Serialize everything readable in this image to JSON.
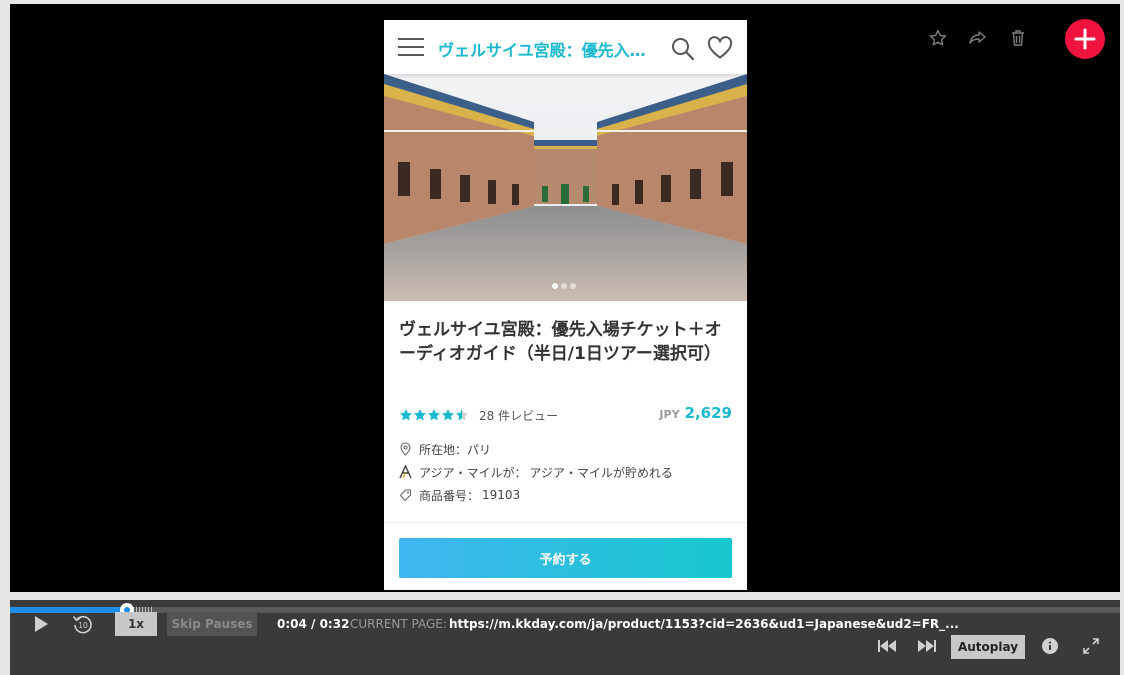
{
  "stage_toolbar": {
    "favorite_icon": "star-outline-icon",
    "share_icon": "share-arrow-icon",
    "delete_icon": "trash-icon",
    "add_icon": "plus-icon",
    "add_color": "#f0123f"
  },
  "phone": {
    "header": {
      "title": "ヴェルサイユ宮殿：優先入…",
      "title_color": "#19b9cf"
    },
    "hero": {
      "slide_count": 3,
      "active_slide": 1
    },
    "product": {
      "title": "ヴェルサイユ宮殿：優先入場チケット＋オーディオガイド（半日/1日ツアー選択可）",
      "rating": 4.5,
      "reviews": "28 件レビュー",
      "currency": "JPY",
      "price": "2,629",
      "location_label": "所在地：",
      "location_value": "パリ",
      "miles_label": "アジア・マイルが：",
      "miles_value": "アジア・マイルが貯めれる",
      "product_no_label": "商品番号：",
      "product_no_value": "19103"
    },
    "book_label": "予約する"
  },
  "player": {
    "progress_played_fraction": 0.105,
    "buffer_fraction": 0.13,
    "speed_label": "1x",
    "skip_pauses_label": "Skip Pauses",
    "time": "0:04 / 0:32",
    "current_page_label": "CURRENT PAGE:",
    "current_page_url": "https://m.kkday.com/ja/product/1153?cid=2636&ud1=Japanese&ud2=FR_...",
    "autoplay_label": "Autoplay",
    "accent_color": "#1b8ee8"
  }
}
